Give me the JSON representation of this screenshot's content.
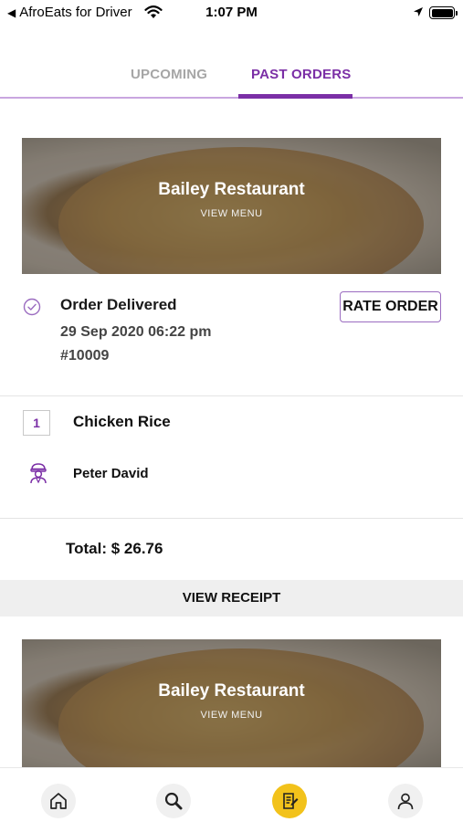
{
  "status_bar": {
    "back_label": "AfroEats for Driver",
    "time": "1:07 PM"
  },
  "tabs": [
    {
      "label": "UPCOMING",
      "active": false
    },
    {
      "label": "PAST ORDERS",
      "active": true
    }
  ],
  "orders": [
    {
      "restaurant": "Bailey Restaurant",
      "view_menu": "VIEW MENU",
      "status": "Order Delivered",
      "date": "29 Sep 2020 06:22 pm",
      "order_id": "#10009",
      "rate_label": "RATE ORDER",
      "items": [
        {
          "qty": "1",
          "name": "Chicken Rice"
        }
      ],
      "driver": "Peter David",
      "total": "Total: $ 26.76",
      "receipt_label": "VIEW RECEIPT"
    },
    {
      "restaurant": "Bailey Restaurant",
      "view_menu": "VIEW MENU"
    }
  ],
  "bottom_nav": [
    {
      "icon": "home-icon",
      "active": false
    },
    {
      "icon": "search-icon",
      "active": false
    },
    {
      "icon": "orders-icon",
      "active": true
    },
    {
      "icon": "profile-icon",
      "active": false
    }
  ],
  "colors": {
    "accent": "#7b2fa6",
    "tab_inactive": "#a6a6a6",
    "nav_active": "#f2c21b",
    "receipt_bg": "#efefef"
  }
}
